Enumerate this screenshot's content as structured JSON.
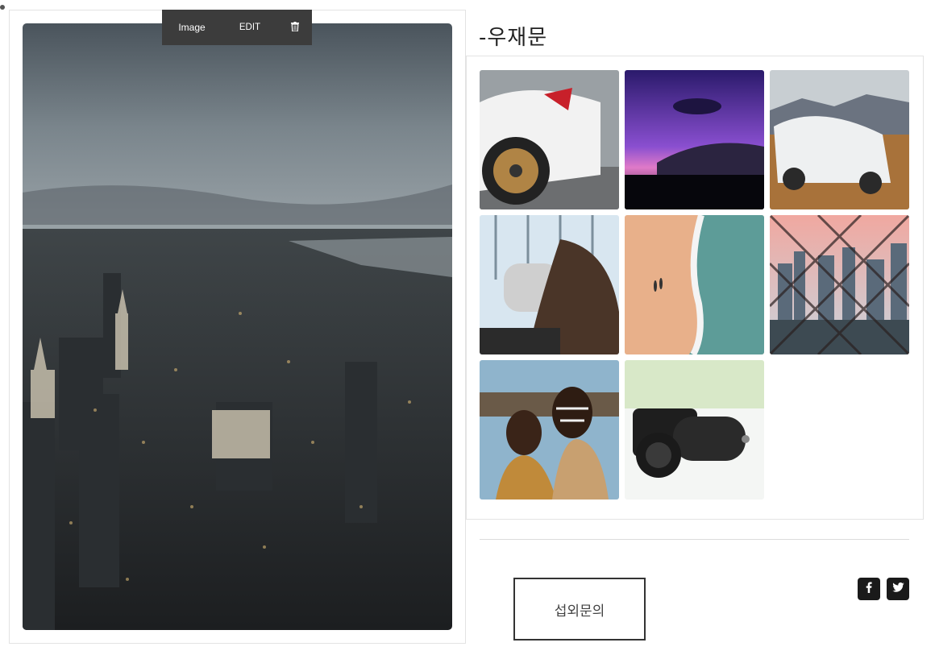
{
  "toolbar": {
    "image_label": "Image",
    "edit_label": "EDIT",
    "delete_icon": "trash-icon"
  },
  "main_image": {
    "description_icon": "city-skyline-photo"
  },
  "gallery": {
    "title": "-우재문",
    "items": [
      {
        "name": "white-sports-car-photo"
      },
      {
        "name": "purple-sunset-photo"
      },
      {
        "name": "white-suv-photo"
      },
      {
        "name": "binocular-viewer-photo"
      },
      {
        "name": "aerial-beach-photo"
      },
      {
        "name": "city-through-fence-photo"
      },
      {
        "name": "face-paint-people-photo"
      },
      {
        "name": "camera-lens-photo"
      }
    ]
  },
  "contact": {
    "button_label": "섭외문의"
  },
  "social": {
    "facebook_icon": "facebook-icon",
    "twitter_icon": "twitter-icon"
  }
}
